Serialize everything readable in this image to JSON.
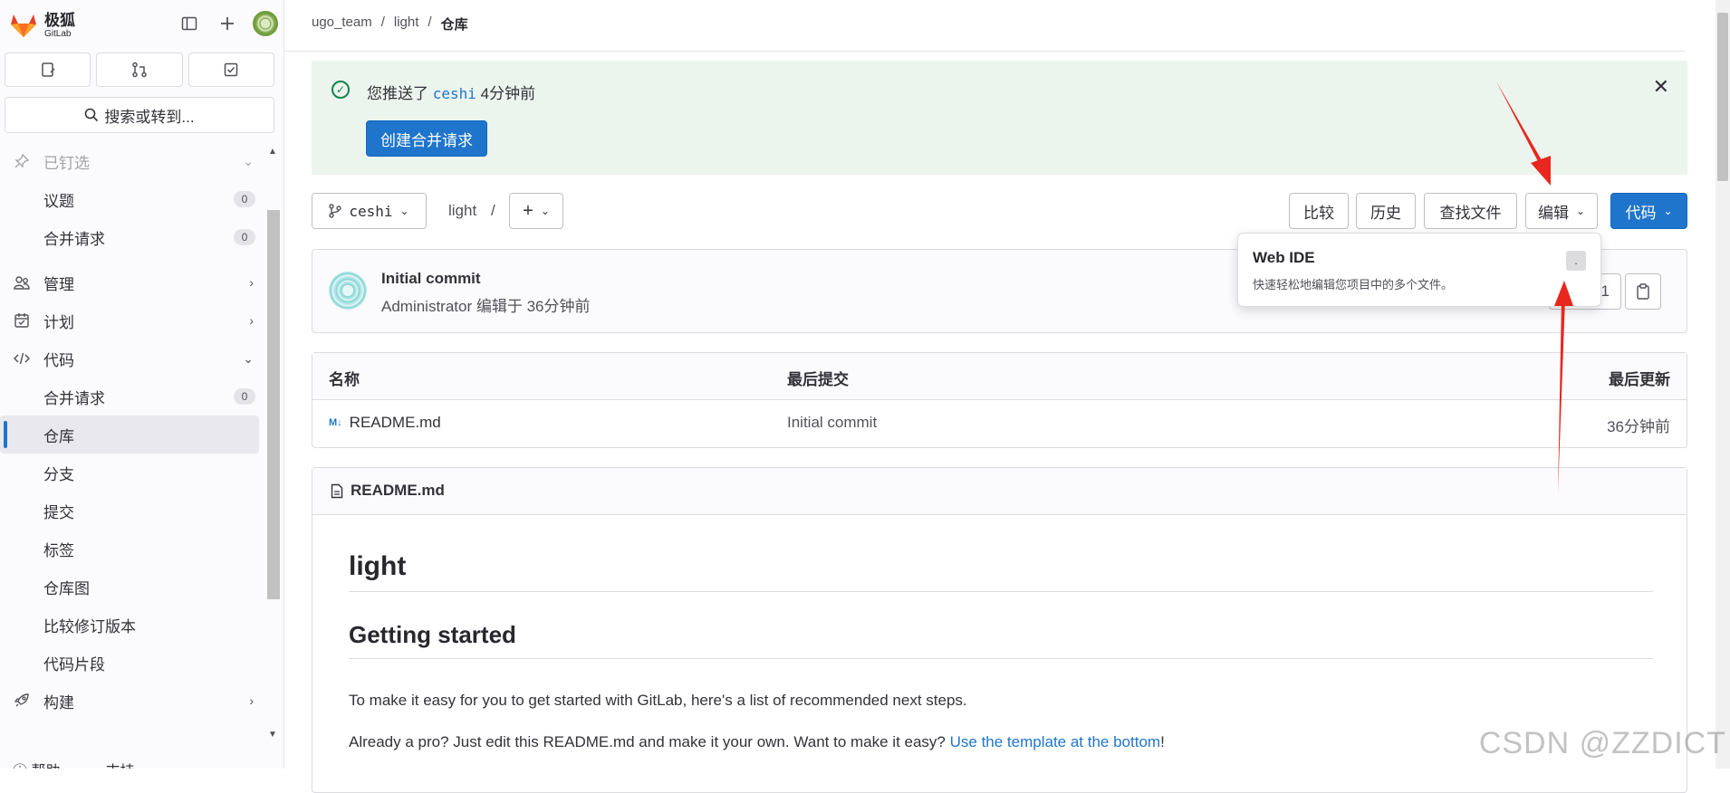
{
  "brand": {
    "name_cn": "极狐",
    "name_en": "GitLab"
  },
  "search": {
    "label": "搜索或转到..."
  },
  "sidebar": {
    "pinned_label": "已钉选",
    "pinned_items": [
      {
        "label": "议题",
        "count": "0"
      },
      {
        "label": "合并请求",
        "count": "0"
      }
    ],
    "sections": [
      {
        "label": "管理"
      },
      {
        "label": "计划"
      },
      {
        "label": "代码"
      }
    ],
    "code_items": [
      {
        "label": "合并请求",
        "count": "0"
      },
      {
        "label": "仓库"
      },
      {
        "label": "分支"
      },
      {
        "label": "提交"
      },
      {
        "label": "标签"
      },
      {
        "label": "仓库图"
      },
      {
        "label": "比较修订版本"
      },
      {
        "label": "代码片段"
      }
    ],
    "build_label": "构建",
    "help_label": "帮助",
    "support_label": "支持"
  },
  "breadcrumb": {
    "group": "ugo_team",
    "project": "light",
    "current": "仓库"
  },
  "alert": {
    "prefix": "您推送了",
    "branch": "ceshi",
    "suffix": "4分钟前",
    "cta": "创建合并请求"
  },
  "toolbar": {
    "branch": "ceshi",
    "path": "light",
    "path_sep": "/",
    "compare": "比较",
    "history": "历史",
    "find_file": "查找文件",
    "edit": "编辑",
    "code": "代码"
  },
  "commit": {
    "title": "Initial commit",
    "author": "Administrator",
    "meta": "编辑于 36分钟前",
    "sha_partial": "91"
  },
  "popover": {
    "title": "Web IDE",
    "desc": "快速轻松地编辑您项目中的多个文件。",
    "shortcut": "."
  },
  "files": {
    "headers": {
      "name": "名称",
      "last_commit": "最后提交",
      "last_update": "最后更新"
    },
    "rows": [
      {
        "name": "README.md",
        "commit": "Initial commit",
        "updated": "36分钟前"
      }
    ]
  },
  "readme": {
    "filename": "README.md",
    "h1": "light",
    "h2": "Getting started",
    "p1": "To make it easy for you to get started with GitLab, here's a list of recommended next steps.",
    "p2_text": "Already a pro? Just edit this README.md and make it your own. Want to make it easy?",
    "p2_link": "Use the template at the bottom",
    "p2_tail": "!"
  },
  "watermark": "CSDN @ZZDICT",
  "colors": {
    "accent": "#1f75cb",
    "success": "#108548",
    "alert_bg": "#ecf4ee",
    "annotation": "#e8271e"
  }
}
